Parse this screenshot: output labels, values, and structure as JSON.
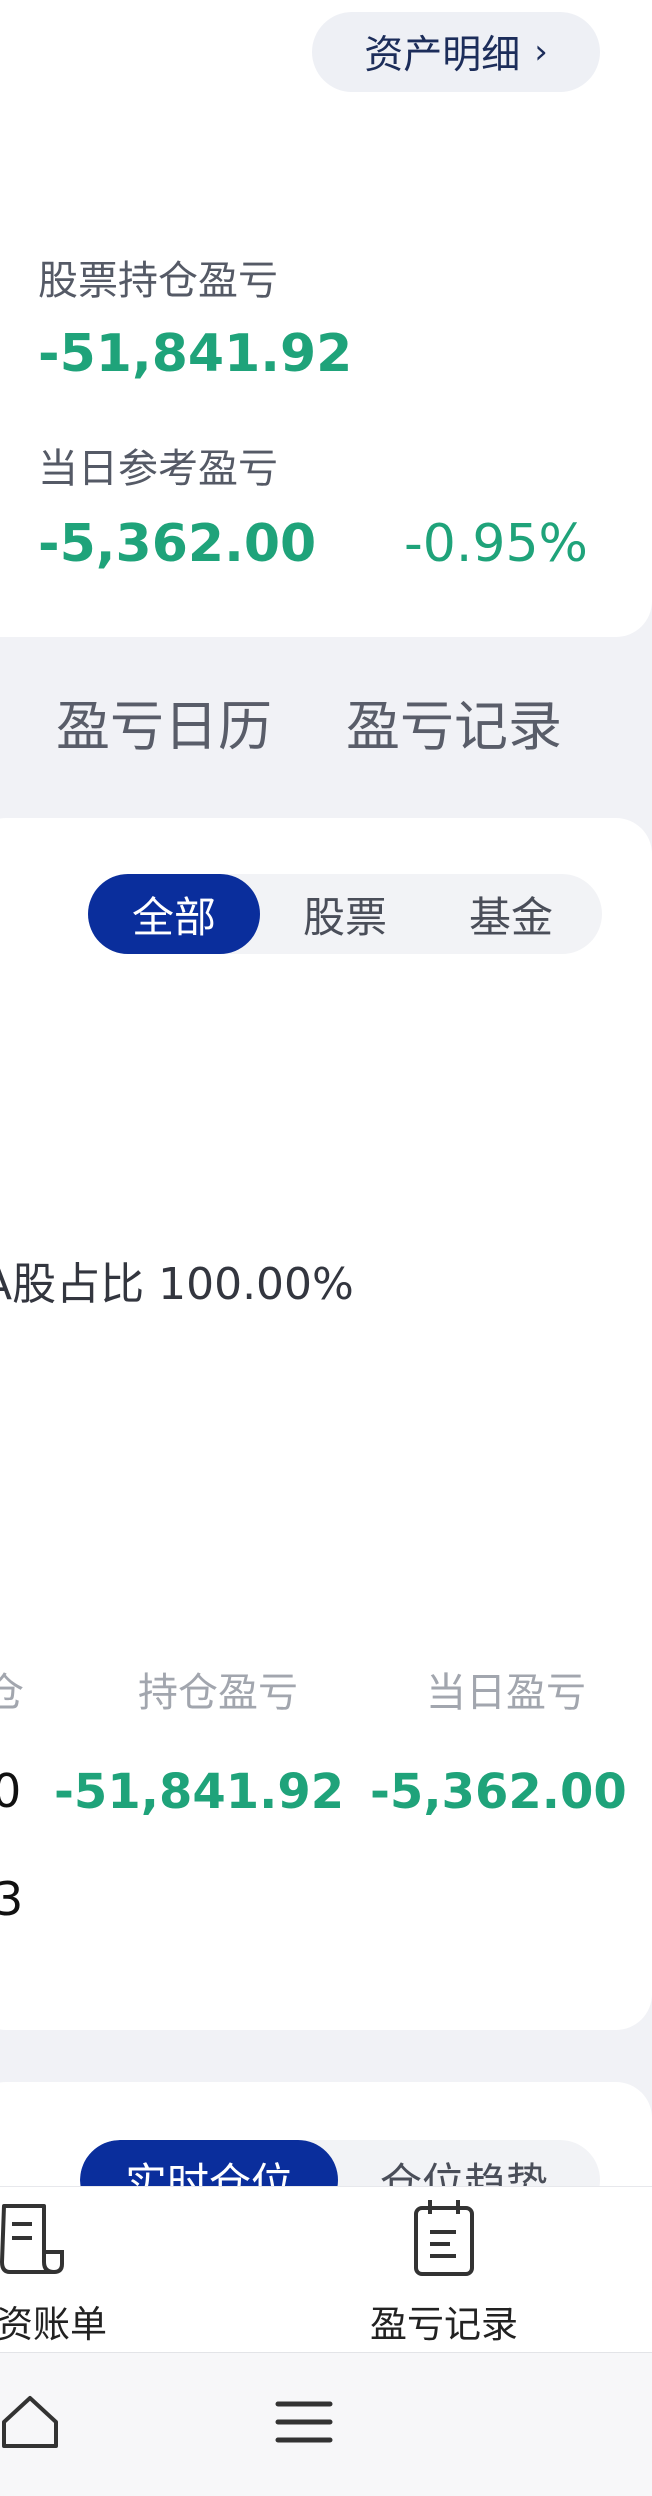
{
  "header": {
    "asset_detail_label": "资产明细",
    "asset_detail_chevron": "›"
  },
  "summary": {
    "stock_pl_label": "股票持仓盈亏",
    "stock_pl_value": "-51,841.92",
    "daily_pl_label": "当日参考盈亏",
    "daily_pl_value": "-5,362.00",
    "daily_pl_percent": "-0.95%"
  },
  "tabs": [
    {
      "label": "盈亏日历"
    },
    {
      "label": "盈亏记录"
    }
  ],
  "filter": {
    "options": [
      "全部",
      "股票",
      "基金"
    ],
    "selected": "全部"
  },
  "allocation": {
    "ratio_text": "A股占比 100.00%"
  },
  "holdings_table": {
    "headers": [
      "仓",
      "持仓盈亏",
      "当日盈亏"
    ],
    "row": {
      "cut_left": "0",
      "holding_pl": "-51,841.92",
      "daily_pl": "-5,362.00",
      "cut_second": "3"
    }
  },
  "position_tabs": {
    "options": [
      "实时仓位",
      "仓位趋势"
    ],
    "selected": "实时仓位"
  },
  "actions": [
    {
      "label": "资账单",
      "icon": "receipt-icon"
    },
    {
      "label": "盈亏记录",
      "icon": "calendar-list-icon"
    }
  ],
  "nav": {
    "icons": [
      "home-icon",
      "menu-icon"
    ]
  },
  "colors": {
    "accent_blue": "#0a2e9c",
    "loss_green": "#1fa37a"
  }
}
